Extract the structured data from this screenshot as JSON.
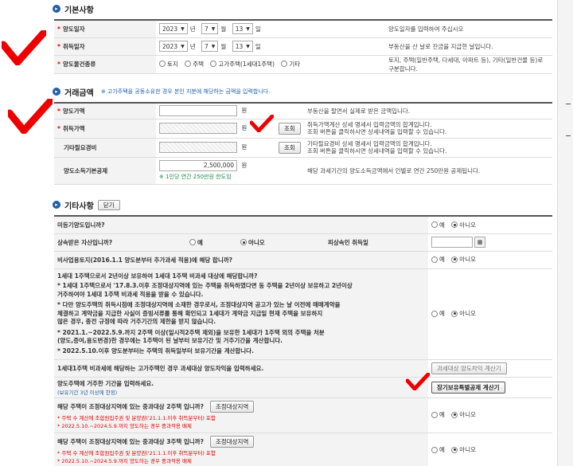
{
  "basic": {
    "title": "기본사항",
    "transfer_date": {
      "label": "양도일자",
      "year": "2023",
      "month": "7",
      "day": "13",
      "desc": "양도일자를 입력하여 주십시오"
    },
    "acquire_date": {
      "label": "취득일자",
      "year": "2023",
      "month": "7",
      "day": "13",
      "desc": "부동산을 산 날로 잔금을 지급한 날입니다."
    },
    "property_type": {
      "label": "양도물건종류",
      "options": [
        "토지",
        "주택",
        "고가주택(1세대1주택)",
        "기타"
      ],
      "desc": "토지, 주택(일반주택, 다세대, 아파트 등), 기타(일반건물 등)로 구분합니다."
    },
    "units": {
      "year": "년",
      "month": "월",
      "day": "일"
    }
  },
  "transaction": {
    "title": "거래금액",
    "note": "※ 고가주택을 공동소유한 경우 본인 지분에 해당하는 금액을 입력합니다.",
    "won": "원",
    "transfer_price": {
      "label": "양도가액",
      "value": "",
      "desc": "부동산을 팔면서 실제로 받은 금액입니다."
    },
    "acquire_price": {
      "label": "취득가액",
      "value": "",
      "button": "조회",
      "desc1": "취득가액계산 상세 명세서 입력금액의 합계입니다.",
      "desc2": "조회 버튼을 클릭하시면 상세내역을 입력할 수 있습니다."
    },
    "other_expense": {
      "label": "기타필요경비",
      "value": "",
      "button": "조회",
      "desc1": "기타필요경비 상세 명세서 입력금액의 합계입니다.",
      "desc2": "조회 버튼을 클릭하시면 상세내역을 입력할 수 있습니다."
    },
    "basic_deduction": {
      "label": "양도소득기본공제",
      "value": "2,500,000",
      "note": "※ 1인당 연간 250만원 한도임",
      "desc": "해당 과세기간의 양도소득금액에서 인별로 연간 250만원 공제됩니다."
    }
  },
  "other": {
    "title": "기타사항",
    "close_button": "닫기",
    "yes": "예",
    "no": "아니오",
    "q_unregistered": "미등기양도입니까?",
    "q_inherited": "상속받은 자산입니까?",
    "inherit_date_label": "피상속인 취득일",
    "cal_icon": "calendar-icon",
    "q_nonbiz": "비사업용토지(2016.1.1 양도분부터 추가과세 적용)에 해당 합니까?",
    "q_1h1h": {
      "title": "1세대 1주택으로서 2년이상 보유하여 1세대 1주택 비과세 대상에 해당합니까?",
      "lines": [
        "* 1세대 1주택으로서 '17.8.3.이후 조정대상지역에 있는 주택을 취득하였다면 동 주택을 2년이상 보유하고 2년이상",
        "거주하여야 1세대 1주택 비과세 적용을 받을 수 있습니다.",
        "* 다만 양도주택의 취득시점에 조정대상지역에 소재한 경우로서, 조정대상지역 공고가 있는 날 이전에 매매계약을",
        "체결하고 계약금을 지급한 사실이 증빙서류를 통해 확인되고 1세대가 계약금 지급일 현재 주택을 보유하지",
        "않은 경우, 종전 규정에 따라 거주기간의 제한을 받지 않습니다.",
        "* 2021.1.~2022.5.9.까지 2주택 이상(일시적2주택 제외)을 보유한 1세대가 1주택 외의 주택을 처분",
        "(양도,증여,용도변경)한 경우에는 1주택이 된 날부터 보유기간 및 거주기간을 계산합니다.",
        "* 2022.5.10.이후 양도분부터는 주택의 취득일부터 보유기간을 계산합니다."
      ]
    },
    "q_highprice": "1세대1주택 비과세에 해당하는 고가주택인 경우 과세대상 양도차익을 입력하세요.",
    "btn_taxable_gain": "과세대상 양도차익 계산기",
    "q_residence": "양도주택에 거주한 기간을 입력하세요.",
    "residence_note": "(보유기간 3년 이상에 한정)",
    "btn_longterm": "장기보유특별공제 계산기",
    "q_2house": "해당 주택이 조정대상지역에 있는 중과대상 2주택 입니까?",
    "q_3house": "해당 주택이 조정대상지역에 있는 중과대상 3주택 입니까?",
    "btn_adjust": "조정대상지역",
    "house_note1": "* 주택 수 계산에 조합원입주권 및 분양권('21.1.1.이후 취득분부터) 포함",
    "house_note2": "* 2022.5.10.~2024.5.9.까지 양도하는 경우 중과적용 배제"
  }
}
